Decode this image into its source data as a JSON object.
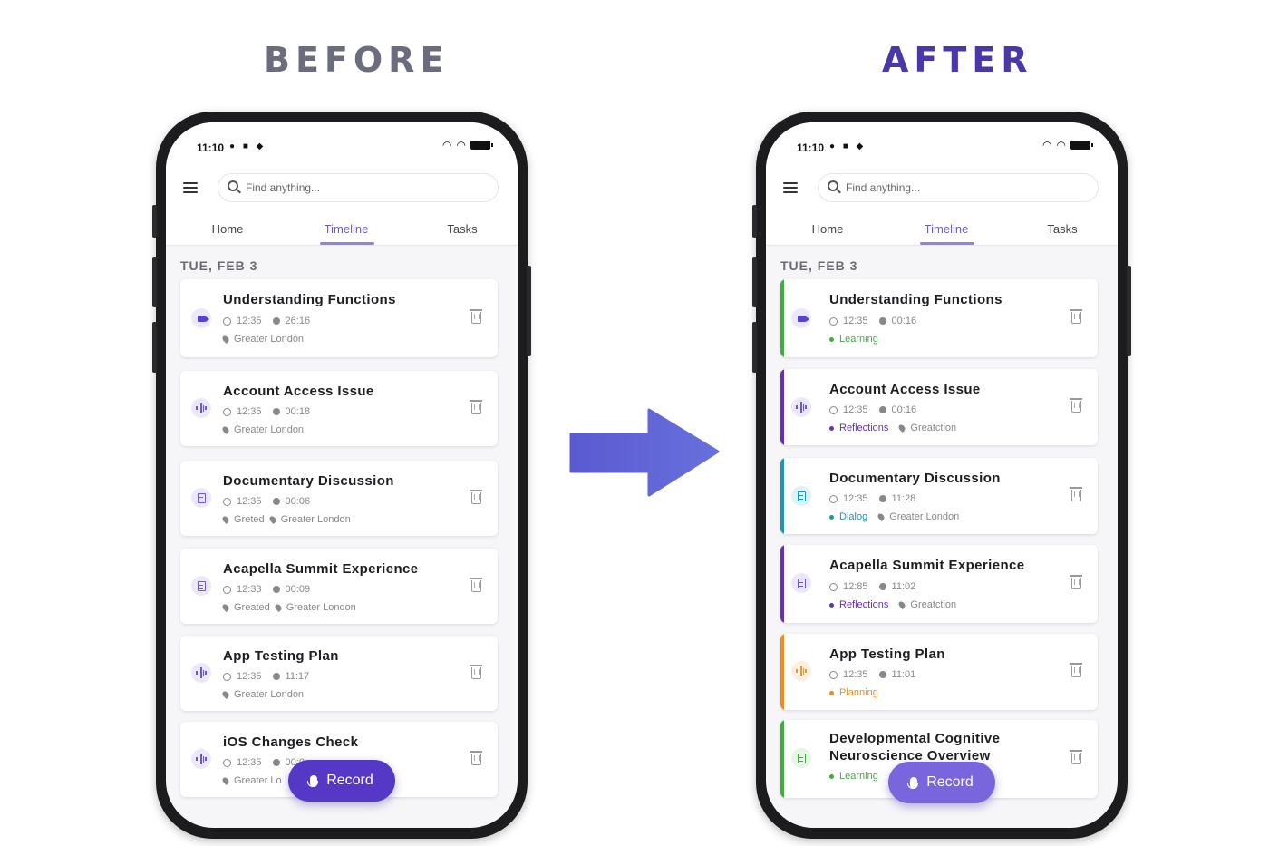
{
  "headings": {
    "before": "BEFORE",
    "after": "AFTER"
  },
  "status": {
    "time": "11:10"
  },
  "search": {
    "placeholder_before": "Find anything...",
    "placeholder_after": "Find anything..."
  },
  "tabs": [
    "Home",
    "Timeline",
    "Tasks"
  ],
  "active_tab": "Timeline",
  "date_label": "TUE, FEB 3",
  "record_label": "Record",
  "colors": {
    "primary": "#5638c7",
    "learning": "#3fae3f",
    "reflections": "#6a2fb3",
    "dialog": "#1a98b3",
    "planning": "#f08b1c"
  },
  "before": {
    "cards": [
      {
        "title": "Understanding Functions",
        "time": "12:35",
        "duration": "26:16",
        "pre": "",
        "location": "Greater London",
        "icon": "video-icon"
      },
      {
        "title": "Account Access Issue",
        "time": "12:35",
        "duration": "00:18",
        "pre": "",
        "location": "Greater London",
        "icon": "waveform-icon"
      },
      {
        "title": "Documentary Discussion",
        "time": "12:35",
        "duration": "00:06",
        "pre": "Greted",
        "location": "Greater London",
        "icon": "document-icon"
      },
      {
        "title": "Acapella Summit Experience",
        "time": "12:33",
        "duration": "00:09",
        "pre": "Greated",
        "location": "Greater London",
        "icon": "document-icon"
      },
      {
        "title": "App Testing Plan",
        "time": "12:35",
        "duration": "11:17",
        "pre": "",
        "location": "Greater London",
        "icon": "waveform-icon"
      },
      {
        "title": "iOS Changes Check",
        "time": "12:35",
        "duration": "00:0",
        "pre": "",
        "location": "Greater Lo",
        "icon": "waveform-icon"
      }
    ]
  },
  "after": {
    "cards": [
      {
        "title": "Understanding Functions",
        "title2": "",
        "time": "12:35",
        "duration": "00:16",
        "tag": "Learning",
        "location": "",
        "icon": "video-icon",
        "accent": "#3fae3f"
      },
      {
        "title": "Account Access Issue",
        "title2": "",
        "time": "12:35",
        "duration": "00:16",
        "tag": "Reflections",
        "location": "Greatction",
        "icon": "waveform-icon",
        "accent": "#6a2fb3"
      },
      {
        "title": "Documentary Discussion",
        "title2": "",
        "time": "12:35",
        "duration": "11:28",
        "tag": "Dialog",
        "location": "Greater London",
        "icon": "document-icon",
        "accent": "#1a98b3"
      },
      {
        "title": "Acapella Summit Experience",
        "title2": "",
        "time": "12:85",
        "duration": "11:02",
        "tag": "Reflections",
        "location": "Greatction",
        "icon": "document-icon",
        "accent": "#6a2fb3"
      },
      {
        "title": "App Testing Plan",
        "title2": "",
        "time": "12:35",
        "duration": "11:01",
        "tag": "Planning",
        "location": "",
        "icon": "waveform-icon",
        "accent": "#f08b1c"
      },
      {
        "title": "Developmental Cognitive",
        "title2": "Neuroscience Overview",
        "time": "",
        "duration": "",
        "tag": "Learning",
        "location": "",
        "icon": "document-icon",
        "accent": "#3fae3f"
      }
    ]
  }
}
